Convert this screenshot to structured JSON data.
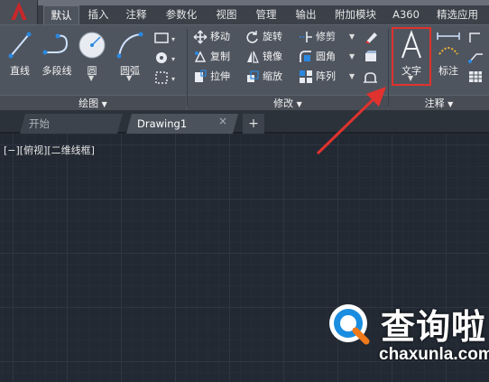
{
  "ribbon_tabs": [
    "默认",
    "插入",
    "注释",
    "参数化",
    "视图",
    "管理",
    "输出",
    "附加模块",
    "A360",
    "精选应用"
  ],
  "draw_panel": {
    "title": "绘图",
    "tools": {
      "line": "直线",
      "polyline": "多段线",
      "circle": "圆",
      "arc": "圆弧"
    }
  },
  "modify_panel": {
    "title": "修改",
    "tools": {
      "move": "移动",
      "rotate": "旋转",
      "trim": "修剪",
      "copy": "复制",
      "mirror": "镜像",
      "fillet": "圆角",
      "stretch": "拉伸",
      "scale": "缩放",
      "array": "阵列"
    }
  },
  "annotation_panel": {
    "title": "注释",
    "tools": {
      "text": "文字",
      "dimension": "标注"
    }
  },
  "file_tabs": {
    "start": "开始",
    "drawing": "Drawing1",
    "close": "×",
    "add": "+"
  },
  "viewport_label": "[−][俯视][二维线框]",
  "watermark": {
    "brand_zh": "查询啦",
    "url": "chaxunla.com"
  },
  "colors": {
    "highlight": "#e0322e",
    "accent": "#0b7bd6",
    "canvas": "#222933"
  },
  "icons": {
    "app": "autocad-a-icon",
    "line": "line-icon",
    "polyline": "polyline-icon",
    "circle": "circle-icon",
    "arc": "arc-icon",
    "move": "move-icon",
    "rotate": "rotate-icon",
    "trim": "trim-icon",
    "copy": "copy-icon",
    "mirror": "mirror-icon",
    "fillet": "fillet-icon",
    "stretch": "stretch-icon",
    "scale": "scale-icon",
    "array": "array-icon",
    "text": "text-a-icon",
    "dimension": "dimension-icon"
  }
}
